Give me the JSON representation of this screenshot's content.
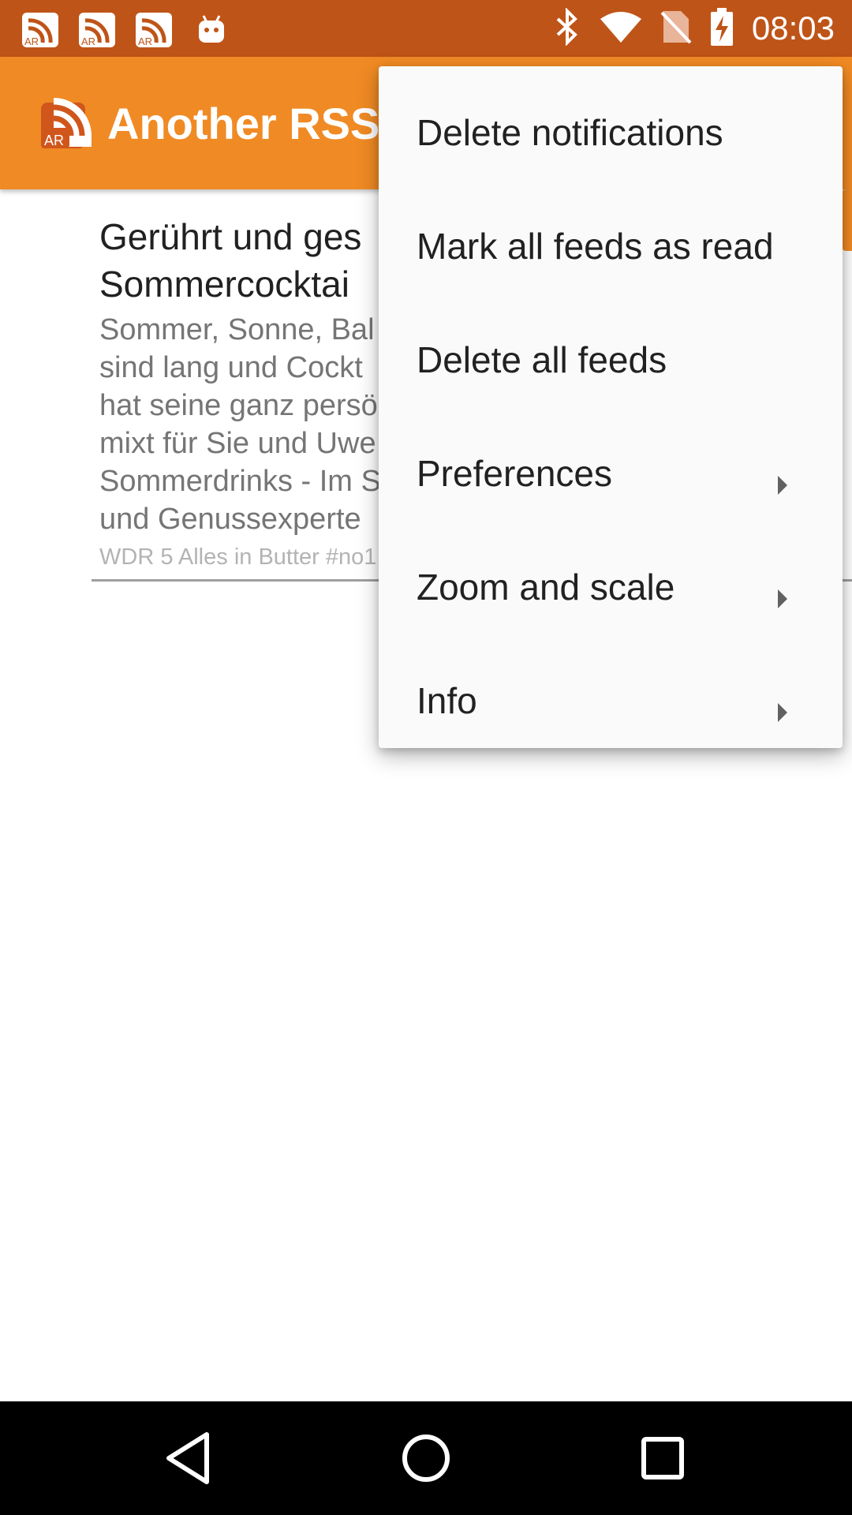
{
  "status_bar": {
    "time": "08:03",
    "notification_icons": [
      "rss-notification-icon",
      "rss-notification-icon",
      "rss-notification-icon",
      "android-icon"
    ],
    "system_icons": [
      "bluetooth-icon",
      "wifi-icon",
      "no-sim-icon",
      "battery-charging-icon"
    ]
  },
  "app_bar": {
    "title": "Another RSS",
    "logo_text": "AR",
    "color": "#f08a24"
  },
  "feed": {
    "items": [
      {
        "title": "Gerührt und ges\nSommercocktai",
        "summary": "Sommer, Sonne, Bal\nsind lang und Cockt\nhat seine ganz persö\nmixt für Sie und Uwe\nSommerdrinks - Im S\nund Genussexperte",
        "meta": "WDR 5 Alles in Butter #no1"
      }
    ]
  },
  "menu": {
    "items": [
      {
        "label": "Delete notifications",
        "submenu": false
      },
      {
        "label": "Mark all feeds as read",
        "submenu": false
      },
      {
        "label": "Delete all feeds",
        "submenu": false
      },
      {
        "label": "Preferences",
        "submenu": true
      },
      {
        "label": "Zoom and scale",
        "submenu": true
      },
      {
        "label": "Info",
        "submenu": true
      }
    ]
  },
  "nav_bar": {
    "buttons": [
      "back-icon",
      "home-icon",
      "recents-icon"
    ]
  },
  "colors": {
    "status_bar": "#bf5418",
    "app_bar": "#f08a24",
    "menu_background": "#fafafa"
  }
}
